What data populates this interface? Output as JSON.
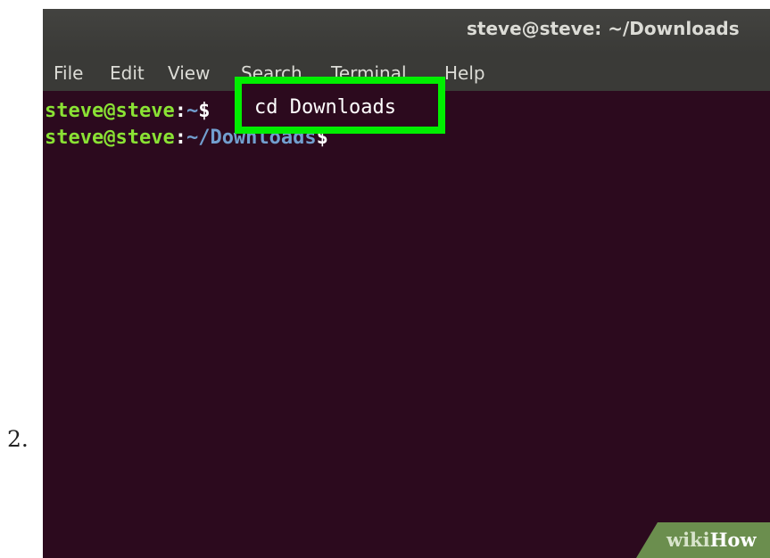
{
  "step": {
    "number": "2."
  },
  "window": {
    "title": "steve@steve: ~/Downloads"
  },
  "menu": {
    "file": "File",
    "edit": "Edit",
    "view": "View",
    "search": "Search",
    "terminal": "Terminal",
    "help": "Help"
  },
  "terminal": {
    "lines": [
      {
        "user_host": "steve@steve",
        "sep": ":",
        "path": "~",
        "prompt": "$",
        "command": "cd Downloads"
      },
      {
        "user_host": "steve@steve",
        "sep": ":",
        "path": "~/Downloads",
        "prompt": "$",
        "command": ""
      }
    ],
    "highlight_color": "#00ee00"
  },
  "watermark": {
    "part1": "wiki",
    "part2": "How"
  },
  "colors": {
    "terminal_bg": "#2c0a1e",
    "titlebar_bg": "#3a3a37",
    "user_host": "#8ae234",
    "path": "#729fcf"
  }
}
